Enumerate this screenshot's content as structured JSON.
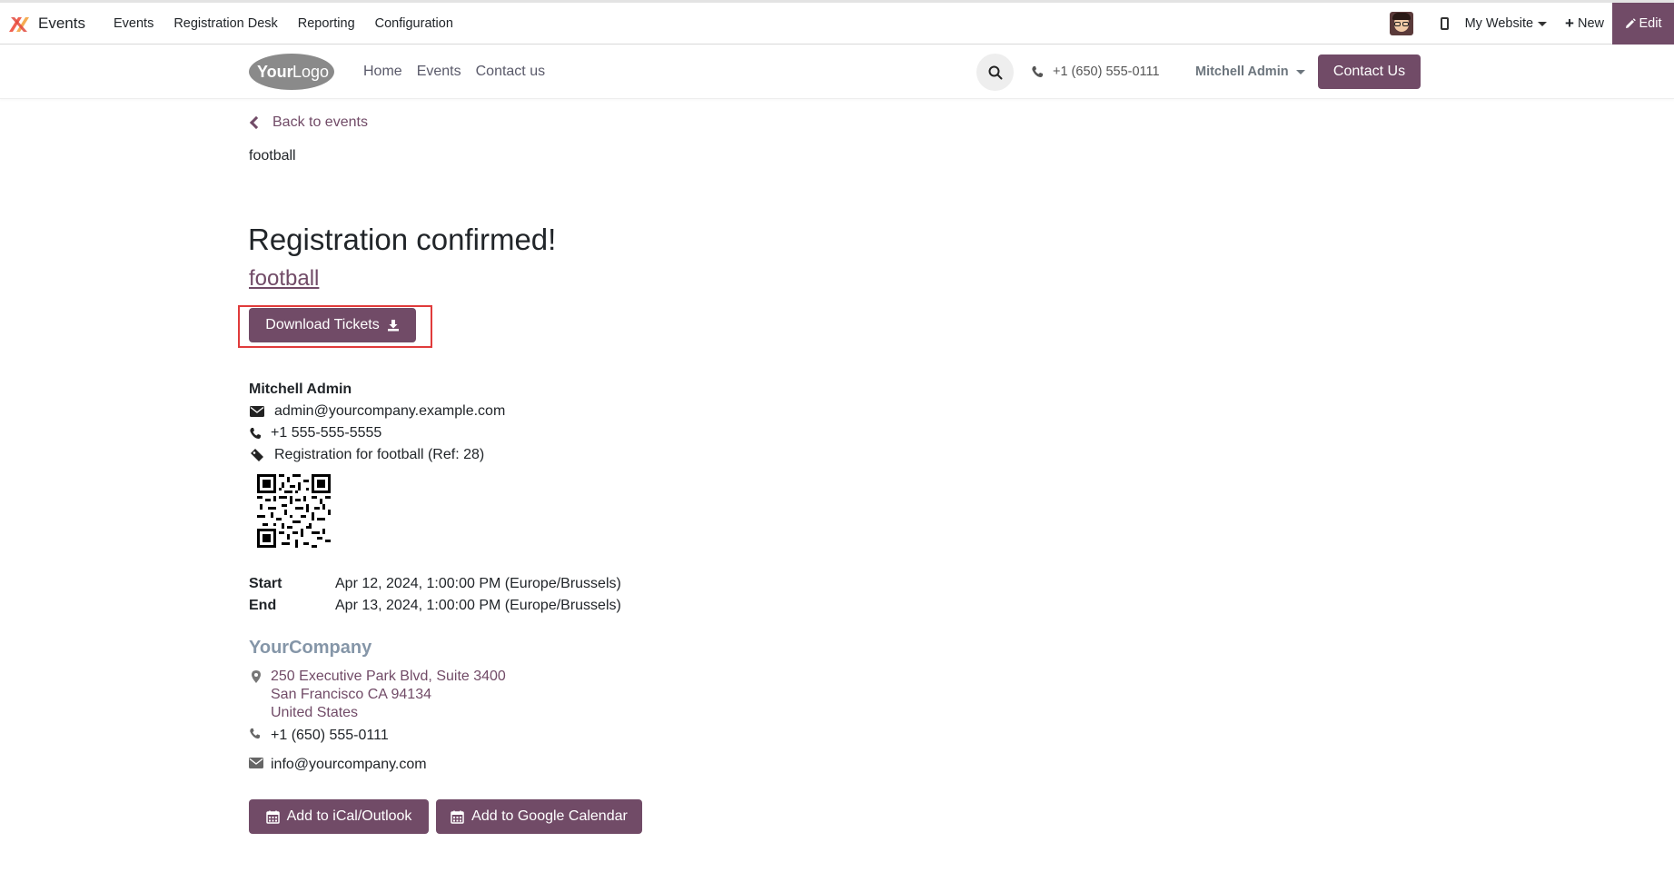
{
  "admin_bar": {
    "app_name": "Events",
    "menu": [
      "Events",
      "Registration Desk",
      "Reporting",
      "Configuration"
    ],
    "website_label": "My Website",
    "new_label": "New",
    "edit_label": "Edit"
  },
  "site_header": {
    "nav": [
      "Home",
      "Events",
      "Contact us"
    ],
    "phone": "+1 (650) 555-0111",
    "user": "Mitchell Admin",
    "contact_button": "Contact Us"
  },
  "page": {
    "back_label": "Back to events",
    "breadcrumb_title": "football",
    "confirm_title": "Registration confirmed!",
    "event_name": "football",
    "download_label": "Download Tickets"
  },
  "attendee": {
    "name": "Mitchell Admin",
    "email": "admin@yourcompany.example.com",
    "phone": "+1 555-555-5555",
    "registration": "Registration for football (Ref: 28)"
  },
  "dates": {
    "start_label": "Start",
    "start_value": "Apr 12, 2024, 1:00:00 PM (Europe/Brussels)",
    "end_label": "End",
    "end_value": "Apr 13, 2024, 1:00:00 PM (Europe/Brussels)"
  },
  "company": {
    "name": "YourCompany",
    "address": [
      "250 Executive Park Blvd, Suite 3400",
      "San Francisco CA 94134",
      "United States"
    ],
    "phone": "+1 (650) 555-0111",
    "email": "info@yourcompany.com"
  },
  "calendar": {
    "ical_label": "Add to iCal/Outlook",
    "google_label": "Add to Google Calendar"
  },
  "colors": {
    "primary": "#714b67",
    "company_name": "#8596a8"
  }
}
